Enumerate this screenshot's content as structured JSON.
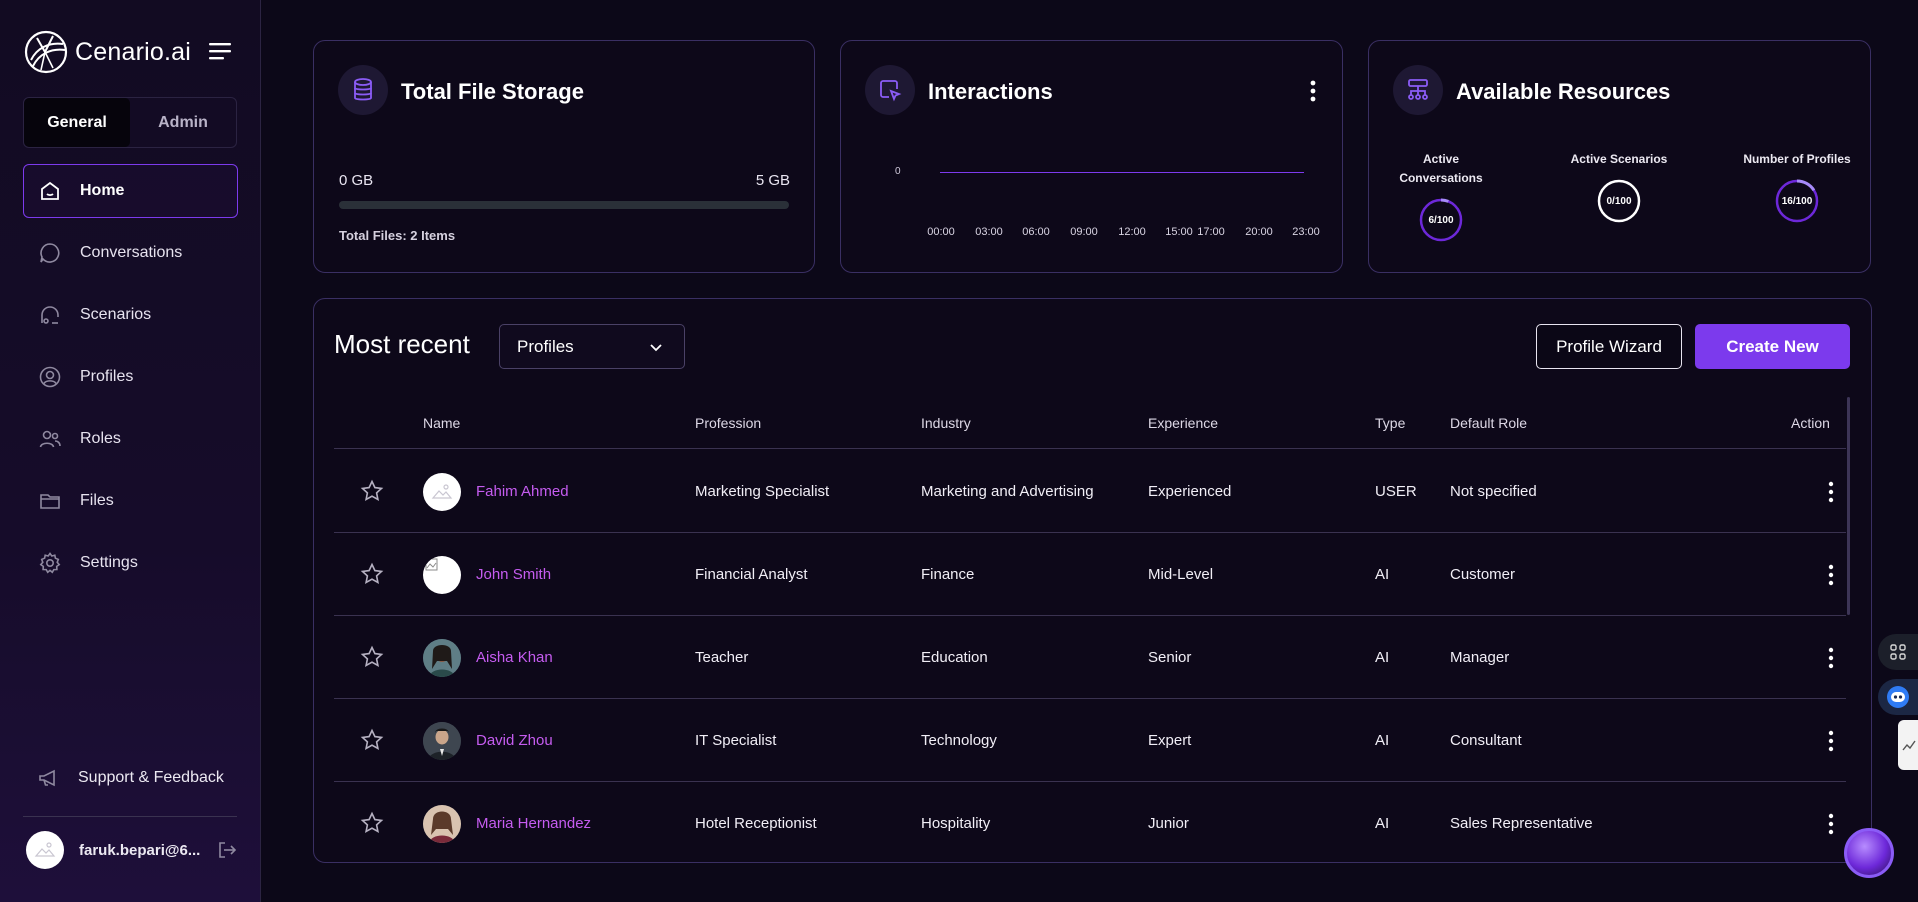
{
  "app": {
    "name": "Cenario.ai"
  },
  "sidebar": {
    "segments": [
      {
        "label": "General",
        "active": true
      },
      {
        "label": "Admin",
        "active": false
      }
    ],
    "items": [
      {
        "label": "Home",
        "icon": "home-icon",
        "active": true
      },
      {
        "label": "Conversations",
        "icon": "chat-bubble-icon"
      },
      {
        "label": "Scenarios",
        "icon": "scenario-icon"
      },
      {
        "label": "Profiles",
        "icon": "user-circle-icon"
      },
      {
        "label": "Roles",
        "icon": "users-icon"
      },
      {
        "label": "Files",
        "icon": "folder-icon"
      },
      {
        "label": "Settings",
        "icon": "gear-icon"
      }
    ],
    "support_label": "Support & Feedback",
    "user_email": "faruk.bepari@6..."
  },
  "storage": {
    "title": "Total File Storage",
    "min_label": "0 GB",
    "max_label": "5 GB",
    "used_fraction": 0,
    "files_label": "Total Files: 2 Items"
  },
  "interactions": {
    "title": "Interactions",
    "chart_data": {
      "type": "line",
      "x": [
        "00:00",
        "03:00",
        "06:00",
        "09:00",
        "12:00",
        "15:00",
        "17:00",
        "20:00",
        "23:00"
      ],
      "series": [
        {
          "values": [
            0,
            0,
            0,
            0,
            0,
            0,
            0,
            0,
            0
          ]
        }
      ],
      "y_ticks": [
        "0"
      ],
      "accent": "#7c3aed"
    }
  },
  "resources": {
    "title": "Available Resources",
    "items": [
      {
        "label": "Active Conversations",
        "value": "6/100",
        "fraction": 0.06
      },
      {
        "label": "Active Scenarios",
        "value": "0/100",
        "fraction": 0
      },
      {
        "label": "Number of Profiles",
        "value": "16/100",
        "fraction": 0.16
      }
    ]
  },
  "recent": {
    "title": "Most recent",
    "select_value": "Profiles",
    "wizard_label": "Profile Wizard",
    "create_label": "Create New",
    "columns": [
      "Name",
      "Profession",
      "Industry",
      "Experience",
      "Type",
      "Default Role",
      "Action"
    ],
    "rows": [
      {
        "name": "Fahim Ahmed",
        "profession": "Marketing Specialist",
        "industry": "Marketing and Advertising",
        "experience": "Experienced",
        "type": "USER",
        "role": "Not specified",
        "avatar": "placeholder"
      },
      {
        "name": "John Smith",
        "profession": "Financial Analyst",
        "industry": "Finance",
        "experience": "Mid-Level",
        "type": "AI",
        "role": "Customer",
        "avatar": "broken"
      },
      {
        "name": "Aisha Khan",
        "profession": "Teacher",
        "industry": "Education",
        "experience": "Senior",
        "type": "AI",
        "role": "Manager",
        "avatar": "photo"
      },
      {
        "name": "David Zhou",
        "profession": "IT Specialist",
        "industry": "Technology",
        "experience": "Expert",
        "type": "AI",
        "role": "Consultant",
        "avatar": "photo"
      },
      {
        "name": "Maria Hernandez",
        "profession": "Hotel Receptionist",
        "industry": "Hospitality",
        "experience": "Junior",
        "type": "AI",
        "role": "Sales Representative",
        "avatar": "photo"
      }
    ]
  },
  "colors": {
    "accent": "#7c3aed",
    "link": "#c55cf0",
    "background": "#0c0818"
  }
}
